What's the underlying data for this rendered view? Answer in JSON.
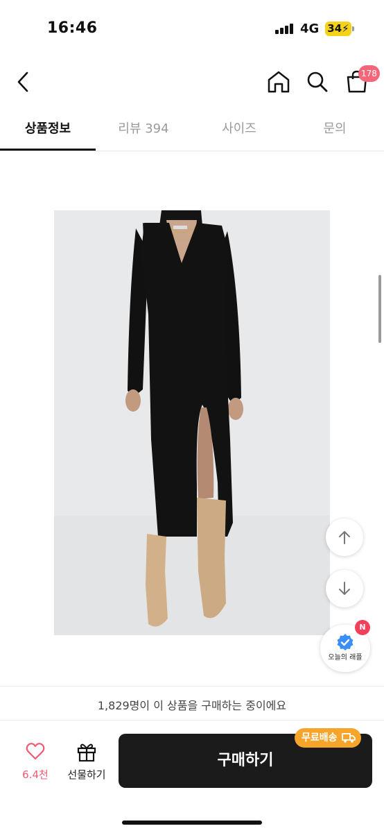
{
  "status_bar": {
    "time": "16:46",
    "network": "4G",
    "battery": "34"
  },
  "header": {
    "back_icon": "chevron-left-icon",
    "home_icon": "home-icon",
    "search_icon": "search-icon",
    "cart_icon": "shopping-bag-icon",
    "cart_count": "178"
  },
  "tabs": [
    {
      "label": "상품정보",
      "active": true
    },
    {
      "label": "리뷰 394",
      "active": false
    },
    {
      "label": "사이즈",
      "active": false
    },
    {
      "label": "문의",
      "active": false
    }
  ],
  "product_image": {
    "description_icon": "product-photo"
  },
  "floating": {
    "up_icon": "arrow-up-icon",
    "down_icon": "arrow-down-icon",
    "raffle_label": "오늘의 래플",
    "raffle_badge": "N"
  },
  "bottom": {
    "buyers_text": "1,829명이 이 상품을 구매하는 중이에요",
    "like_count": "6.4천",
    "gift_label": "선물하기",
    "buy_label": "구매하기",
    "free_shipping_label": "무료배송"
  },
  "colors": {
    "accent_pink": "#f25a73",
    "buy_button": "#1b1b1b",
    "free_shipping": "#f7a52a",
    "raffle_blue": "#3a8ef6"
  }
}
